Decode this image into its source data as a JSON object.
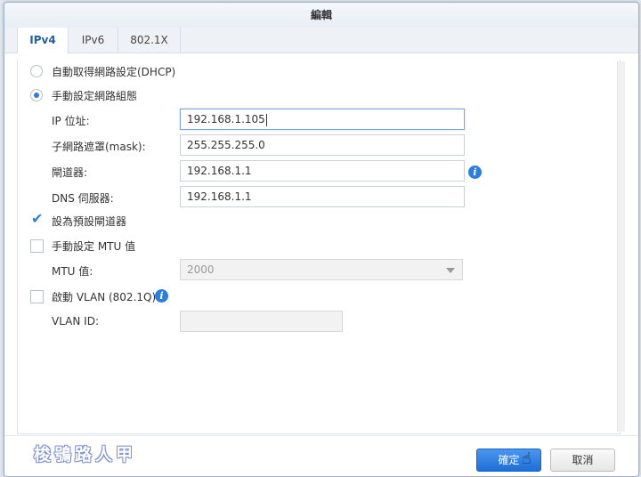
{
  "dialog": {
    "title": "編輯"
  },
  "tabs": [
    {
      "label": "IPv4",
      "active": true
    },
    {
      "label": "IPv6",
      "active": false
    },
    {
      "label": "802.1X",
      "active": false
    }
  ],
  "ipv4": {
    "auto_dhcp_label": "自動取得網路設定(DHCP)",
    "auto_dhcp_selected": false,
    "manual_label": "手動設定網路組態",
    "manual_selected": true,
    "ip_label": "IP 位址:",
    "ip_value": "192.168.1.105",
    "mask_label": "子網路遮罩(mask):",
    "mask_value": "255.255.255.0",
    "gateway_label": "閘道器:",
    "gateway_value": "192.168.1.1",
    "dns_label": "DNS 伺服器:",
    "dns_value": "192.168.1.1",
    "default_gateway_label": "設為預設閘道器",
    "default_gateway_checked": true,
    "manual_mtu_label": "手動設定 MTU 值",
    "manual_mtu_checked": false,
    "mtu_label": "MTU 值:",
    "mtu_value": "2000",
    "vlan_label": "啟動 VLAN (802.1Q)",
    "vlan_checked": false,
    "vlan_id_label": "VLAN ID:",
    "vlan_id_value": ""
  },
  "footer": {
    "ok_label": "確定",
    "cancel_label": "取消",
    "watermark": "梭鴞路人甲"
  },
  "icons": {
    "info": "info-icon",
    "check": "checkmark-icon",
    "dropdown": "chevron-down-icon",
    "cursor": "hand-pointer-icon"
  },
  "colors": {
    "accent": "#2a7de1",
    "primary_button": "#1d6ed8"
  }
}
